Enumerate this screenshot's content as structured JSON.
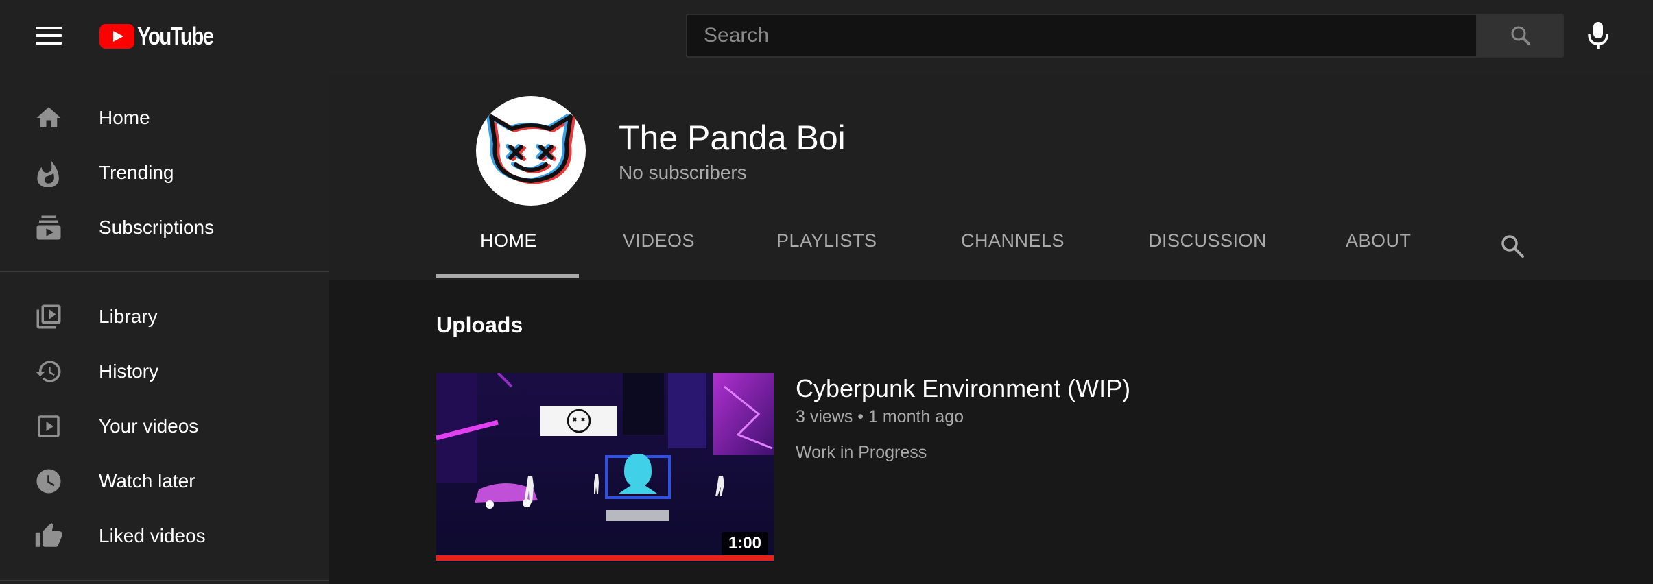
{
  "header": {
    "logo_text": "YouTube",
    "search_placeholder": "Search"
  },
  "sidebar": {
    "items": [
      {
        "label": "Home",
        "icon": "home-icon"
      },
      {
        "label": "Trending",
        "icon": "trending-icon"
      },
      {
        "label": "Subscriptions",
        "icon": "subscriptions-icon"
      },
      {
        "label": "Library",
        "icon": "library-icon"
      },
      {
        "label": "History",
        "icon": "history-icon"
      },
      {
        "label": "Your videos",
        "icon": "your-videos-icon"
      },
      {
        "label": "Watch later",
        "icon": "watch-later-icon"
      },
      {
        "label": "Liked videos",
        "icon": "liked-videos-icon"
      }
    ]
  },
  "channel": {
    "name": "The Panda Boi",
    "subscribers": "No subscribers",
    "tabs": [
      {
        "label": "HOME",
        "active": true
      },
      {
        "label": "VIDEOS"
      },
      {
        "label": "PLAYLISTS"
      },
      {
        "label": "CHANNELS"
      },
      {
        "label": "DISCUSSION"
      },
      {
        "label": "ABOUT"
      }
    ]
  },
  "uploads": {
    "title": "Uploads",
    "videos": [
      {
        "title": "Cyberpunk Environment (WIP)",
        "meta": "3 views • 1 month ago",
        "description": "Work in Progress",
        "duration": "1:00",
        "watched_fraction": 1.0
      }
    ]
  },
  "colors": {
    "brand_red": "#ff0000",
    "background": "#181818",
    "panel": "#212121",
    "progress_red": "#e62117"
  }
}
